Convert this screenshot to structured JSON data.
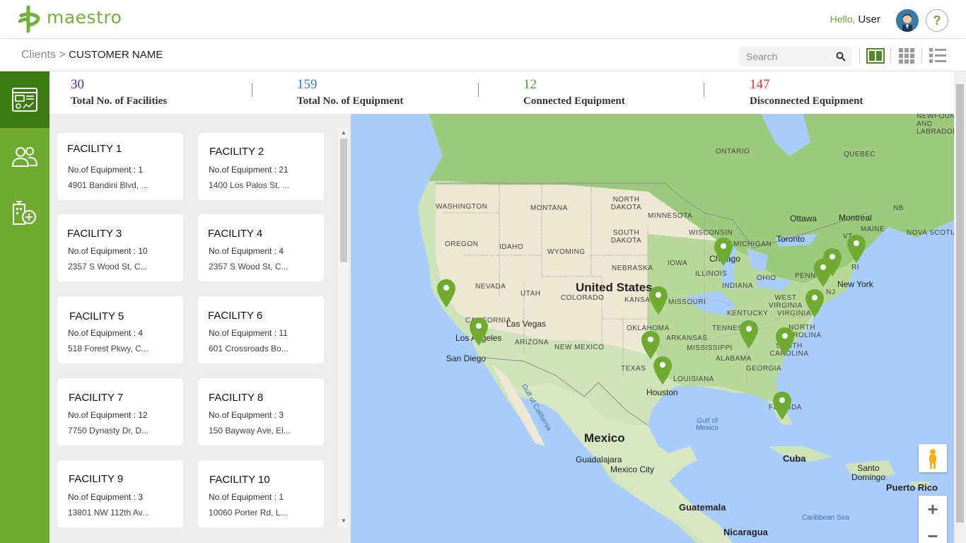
{
  "app": {
    "brand": "maestro"
  },
  "header": {
    "greeting": "Hello,",
    "user": "User",
    "help_label": "?"
  },
  "breadcrumb": {
    "parent": "Clients",
    "separator": ">",
    "current": "CUSTOMER NAME"
  },
  "search": {
    "placeholder": "Search"
  },
  "stats": [
    {
      "value": "30",
      "label": "Total No. of Facilities",
      "color": "#5a2ca0"
    },
    {
      "value": "159",
      "label": "Total No. of Equipment",
      "color": "#2f7bd0"
    },
    {
      "value": "12",
      "label": "Connected Equipment",
      "color": "#4f9a2d"
    },
    {
      "value": "147",
      "label": "Disconnected Equipment",
      "color": "#e03030"
    }
  ],
  "facilities": [
    {
      "name": "FACILITY 1",
      "count": "No.of Equipment : 1",
      "address": "4901 Bandini Blvd, ..."
    },
    {
      "name": "FACILITY 2",
      "count": "No.of Equipment : 21",
      "address": "1400 Los Palos St, ..."
    },
    {
      "name": "FACILITY 3",
      "count": "No.of Equipment : 10",
      "address": "2357 S Wood St, C..."
    },
    {
      "name": "FACILITY 4",
      "count": "No.of Equipment : 4",
      "address": "2357 S Wood St, C..."
    },
    {
      "name": "FACILITY 5",
      "count": "No.of Equipment : 4",
      "address": "518 Forest Pkwy, C..."
    },
    {
      "name": "FACILITY 6",
      "count": "No.of Equipment : 11",
      "address": "601 Crossroads Bo..."
    },
    {
      "name": "FACILITY 7",
      "count": "No.of Equipment : 12",
      "address": "7750 Dynasty Dr, D..."
    },
    {
      "name": "FACILITY 8",
      "count": "No.of Equipment : 3",
      "address": "150 Bayway Ave, El..."
    },
    {
      "name": "FACILITY 9",
      "count": "No.of Equipment : 3",
      "address": "13801 NW 112th Av..."
    },
    {
      "name": "FACILITY 10",
      "count": "No.of Equipment : 1",
      "address": "10060 Porter Rd, L..."
    }
  ],
  "map": {
    "regions": [
      "WASHINGTON",
      "OREGON",
      "IDAHO",
      "MONTANA",
      "WYOMING",
      "NEVADA",
      "UTAH",
      "CALIFORNIA",
      "ARIZONA",
      "COLORADO",
      "NEW MEXICO",
      "NORTH DAKOTA",
      "SOUTH DAKOTA",
      "NEBRASKA",
      "KANSAS",
      "OKLAHOMA",
      "TEXAS",
      "MINNESOTA",
      "IOWA",
      "MISSOURI",
      "ARKANSAS",
      "LOUISIANA",
      "WISCONSIN",
      "ILLINOIS",
      "MICHIGAN",
      "INDIANA",
      "OHIO",
      "KENTUCKY",
      "TENNESSEE",
      "MISSISSIPPI",
      "ALABAMA",
      "GEORGIA",
      "WEST VIRGINIA",
      "VIRGINIA",
      "NORTH CAROLINA",
      "SOUTH CAROLINA",
      "FLORIDA",
      "PENN",
      "NJ",
      "VT",
      "RI",
      "MAINE",
      "ONTARIO",
      "QUEBEC",
      "NB",
      "NOVA SCOTIA",
      "NEWFOUNDLAND AND LABRADOR"
    ],
    "cities": [
      "Chicago",
      "Toronto",
      "Ottawa",
      "Montreal",
      "New York",
      "Los Angeles",
      "San Diego",
      "Las Vegas",
      "Houston",
      "Guadalajara",
      "Mexico City",
      "Santo Domingo"
    ],
    "countries": [
      "United States",
      "Mexico",
      "Cuba",
      "Guatemala",
      "Nicaragua",
      "Puerto Rico"
    ],
    "waters": [
      "Gulf of California",
      "Gulf of Mexico",
      "Caribbean Sea"
    ],
    "marker_color": "#6fab31"
  },
  "theme": {
    "accent": "#6fab31",
    "accent_dark": "#3c7a12"
  }
}
